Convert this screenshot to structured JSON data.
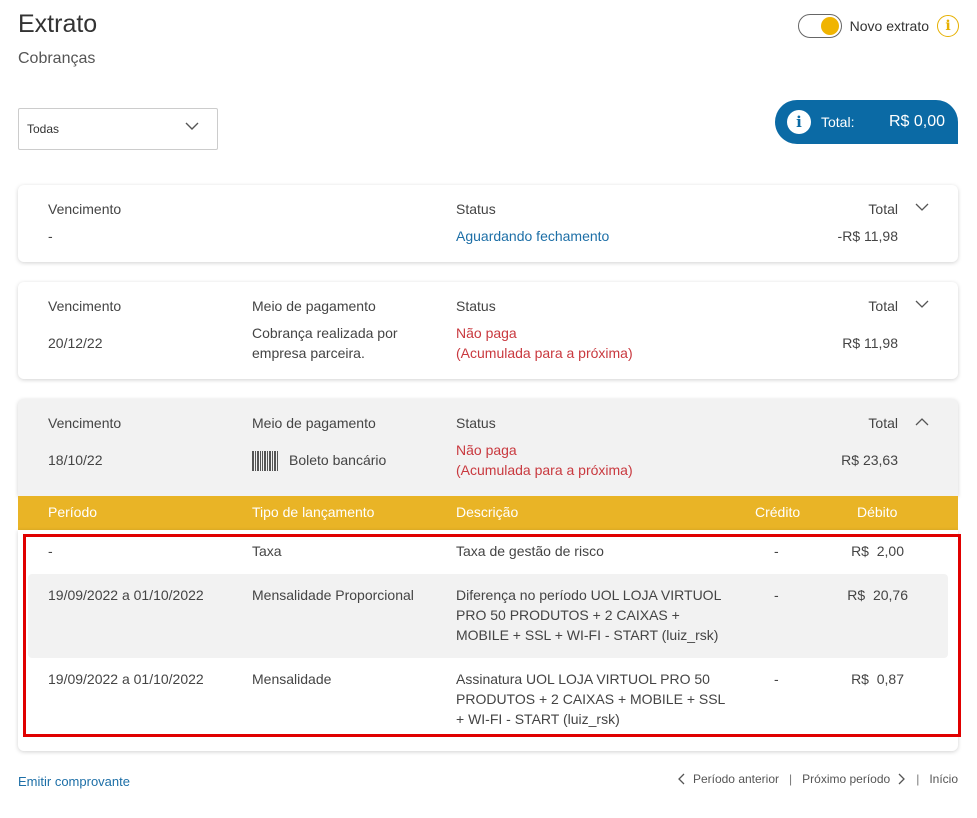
{
  "header": {
    "title": "Extrato",
    "subtitle": "Cobranças",
    "toggle_label": "Novo extrato",
    "toggle_on": true,
    "info_icon": "info-icon"
  },
  "filter": {
    "selected": "Todas"
  },
  "total": {
    "label": "Total:",
    "value": "R$ 0,00"
  },
  "cards": [
    {
      "vencimento_label": "Vencimento",
      "vencimento": "-",
      "status_label": "Status",
      "status": "Aguardando fechamento",
      "total_label": "Total",
      "total": "-R$ 11,98"
    },
    {
      "vencimento_label": "Vencimento",
      "vencimento": "20/12/22",
      "meio_label": "Meio de pagamento",
      "meio_line1": "Cobrança realizada por",
      "meio_line2": "empresa parceira.",
      "status_label": "Status",
      "status_line1": "Não paga",
      "status_line2": "(Acumulada para a próxima)",
      "total_label": "Total",
      "total": "R$ 11,98"
    },
    {
      "vencimento_label": "Vencimento",
      "vencimento": "18/10/22",
      "meio_label": "Meio de pagamento",
      "meio": "Boleto bancário",
      "status_label": "Status",
      "status_line1": "Não paga",
      "status_line2": "(Acumulada para a próxima)",
      "total_label": "Total",
      "total": "R$ 23,63"
    }
  ],
  "details": {
    "headers": [
      "Período",
      "Tipo de lançamento",
      "Descrição",
      "Crédito",
      "Débito"
    ],
    "rows": [
      {
        "periodo": "-",
        "tipo": "Taxa",
        "descricao": [
          "Taxa de gestão de risco"
        ],
        "credito": "-",
        "debito": "R$  2,00"
      },
      {
        "periodo": "19/09/2022 a 01/10/2022",
        "tipo": "Mensalidade Proporcional",
        "descricao": [
          "Diferença no período UOL LOJA VIRTUOL",
          "PRO 50 PRODUTOS + 2 CAIXAS +",
          "MOBILE + SSL + WI-FI - START (luiz_rsk)"
        ],
        "credito": "-",
        "debito": "R$  20,76"
      },
      {
        "periodo": "19/09/2022 a 01/10/2022",
        "tipo": "Mensalidade",
        "descricao": [
          "Assinatura UOL LOJA VIRTUOL PRO 50",
          "PRODUTOS + 2 CAIXAS + MOBILE + SSL",
          "+ WI-FI - START (luiz_rsk)"
        ],
        "credito": "-",
        "debito": "R$  0,87"
      }
    ]
  },
  "footer": {
    "emitir": "Emitir comprovante",
    "anterior": "Período anterior",
    "proximo": "Próximo período",
    "inicio": "Início"
  },
  "colors": {
    "accent_blue": "#0b6aa5",
    "accent_yellow": "#e9b426",
    "status_red": "#c9393f",
    "link_blue": "#1d6fa7",
    "highlight_red": "#e00000"
  }
}
